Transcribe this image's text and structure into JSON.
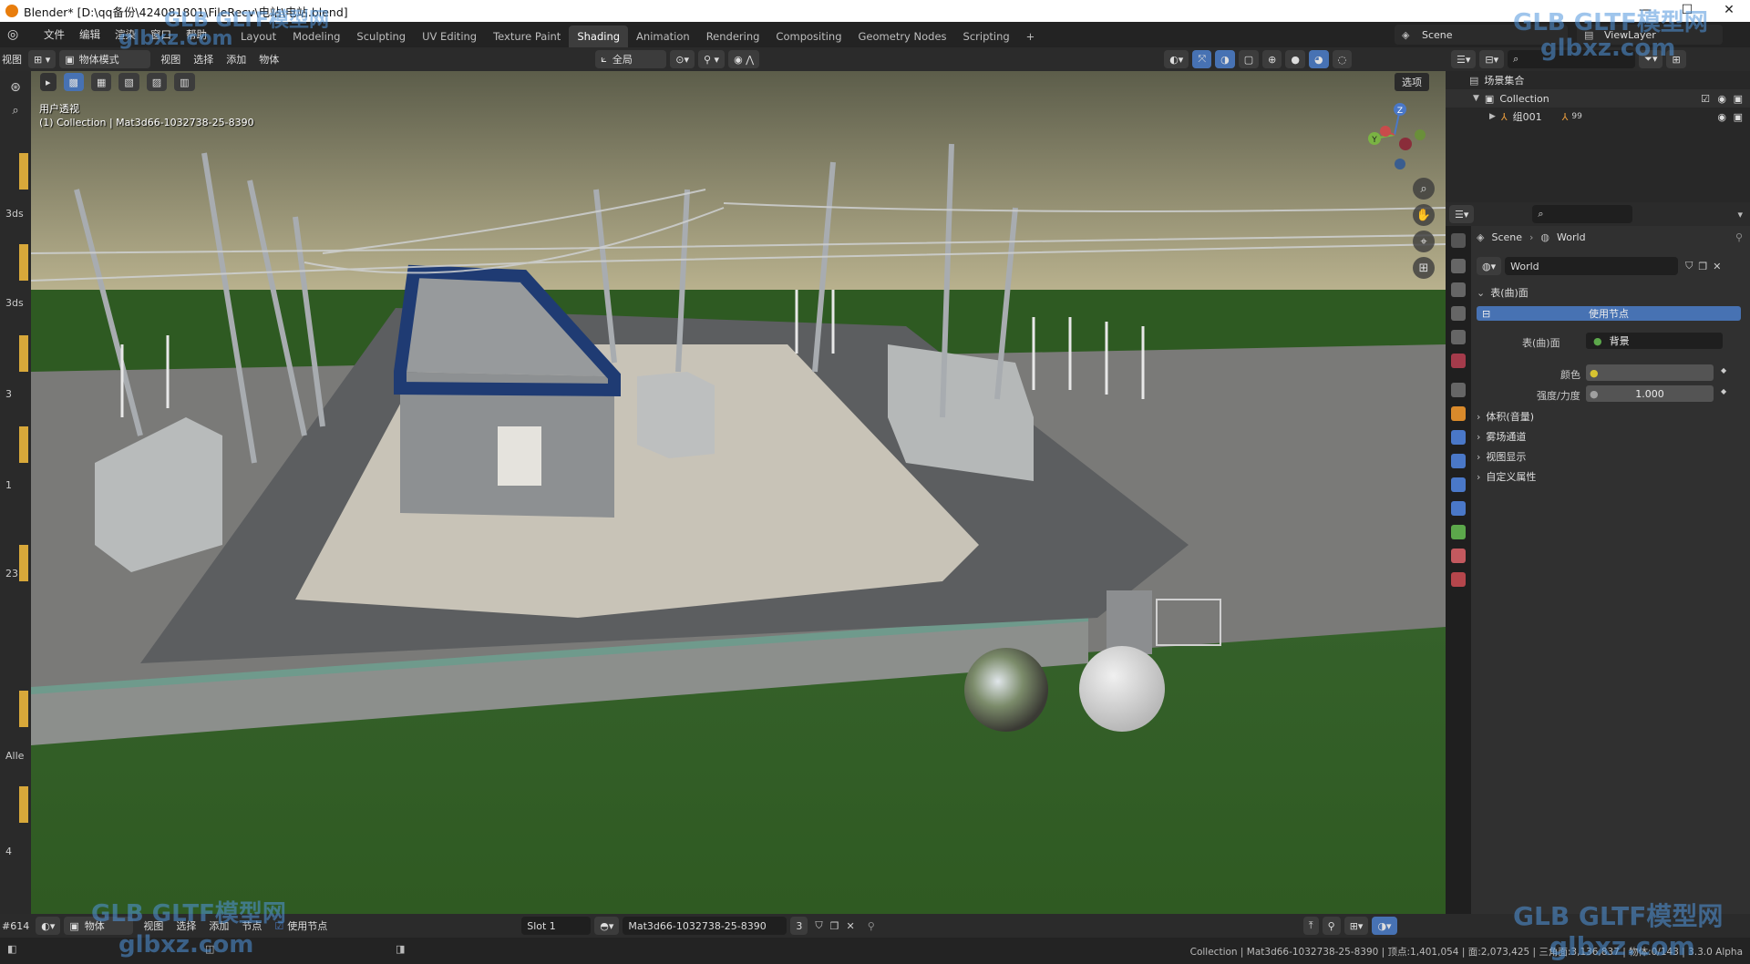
{
  "title": "Blender* [D:\\qq备份\\424081801\\FileRecv\\电站\\电站.blend]",
  "window_controls": [
    "—",
    "☐",
    "✕"
  ],
  "menu": [
    "文件",
    "编辑",
    "渲染",
    "窗口",
    "帮助"
  ],
  "workspaces": [
    "Layout",
    "Modeling",
    "Sculpting",
    "UV Editing",
    "Texture Paint",
    "Shading",
    "Animation",
    "Rendering",
    "Compositing",
    "Geometry Nodes",
    "Scripting"
  ],
  "active_workspace": "Shading",
  "add_workspace": "+",
  "scene_name": "Scene",
  "view_layer": "ViewLayer",
  "viewport_header": {
    "editor_menu": "视图",
    "mode": "物体模式",
    "items": [
      "视图",
      "选择",
      "添加",
      "物体"
    ],
    "transform_orientation": "全局"
  },
  "viewport": {
    "label1": "用户透视",
    "label2": "(1) Collection | Mat3d66-1032738-25-8390",
    "options": "选项"
  },
  "gizmo": {
    "z": "Z",
    "y": "Y"
  },
  "left_strip_labels": [
    "3ds",
    "3ds",
    "3",
    "1",
    "23",
    "Alle",
    "4"
  ],
  "outliner": {
    "root": "场景集合",
    "collection": "Collection",
    "child": "组001",
    "badge": "99"
  },
  "properties": {
    "breadcrumb_scene": "Scene",
    "breadcrumb_world": "World",
    "world_name": "World",
    "surface_panel": "表(曲)面",
    "use_nodes": "使用节点",
    "surface_label": "表(曲)面",
    "surface_value": "背景",
    "color_label": "颜色",
    "strength_label": "强度/力度",
    "strength_value": "1.000",
    "panels": [
      "体积(音量)",
      "雾场通道",
      "视图显示",
      "自定义属性"
    ]
  },
  "status_bar": {
    "counter": "#614",
    "object_menu": "物体",
    "items": [
      "视图",
      "选择",
      "添加",
      "节点"
    ],
    "use_nodes": "使用节点",
    "slot": "Slot 1",
    "material": "Mat3d66-1032738-25-8390",
    "users": "3"
  },
  "info_bar": "Collection | Mat3d66-1032738-25-8390 | 顶点:1,401,054 | 面:2,073,425 | 三角面:3,136,837 | 物体:0/143 | 3.3.0 Alpha",
  "watermarks": {
    "brand": "GLB GLTF模型网",
    "site": "glbxz.com"
  },
  "colors": {
    "accent_blue": "#4772b3",
    "sky": "#b7b08a",
    "grass": "#3c6b2a",
    "building_top": "#1f3b73"
  }
}
